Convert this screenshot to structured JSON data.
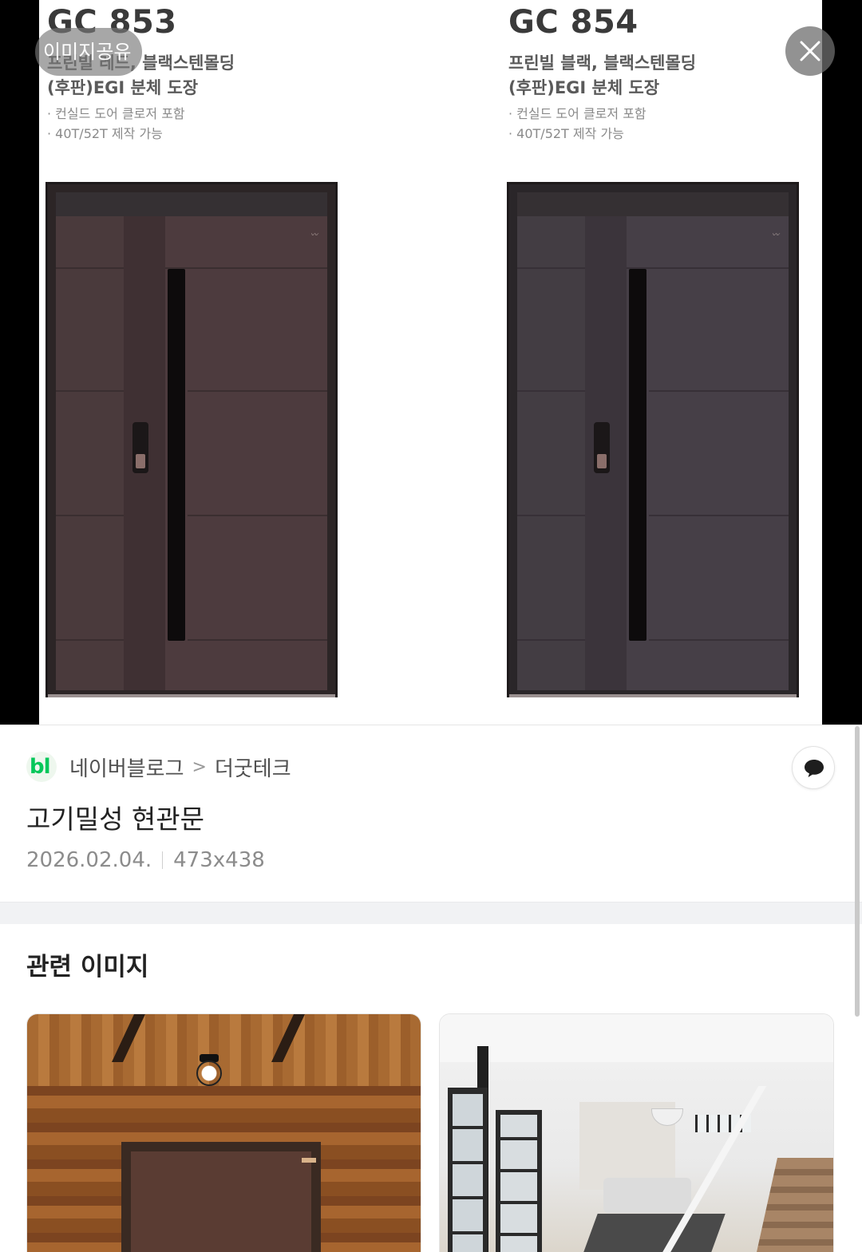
{
  "viewer": {
    "share_label": "이미지공유",
    "products": [
      {
        "model": "GC 853",
        "finish_line1": "프린빌 레드, 블랙스텐몰딩",
        "finish_line2": "(후판)EGI 분체 도장",
        "bullet1": "· 컨실드 도어 클로저 포함",
        "bullet2": "· 40T/52T 제작 가능"
      },
      {
        "model": "GC 854",
        "finish_line1": "프린빌 블랙, 블랙스텐몰딩",
        "finish_line2": "(후판)EGI 분체 도장",
        "bullet1": "· 컨실드 도어 클로저 포함",
        "bullet2": "· 40T/52T 제작 가능"
      }
    ]
  },
  "info": {
    "source_logo": "bl",
    "source_name": "네이버블로그",
    "separator": ">",
    "blog_name": "더굿테크",
    "title": "고기밀성 현관문",
    "date": "2026.02.04.",
    "dimensions": "473x438"
  },
  "related": {
    "heading": "관련 이미지"
  },
  "colors": {
    "naver_green": "#03c75a",
    "door_red_brown": "#4d3b3e",
    "door_black_brown": "#463f47"
  },
  "icons": {
    "close": "close-icon",
    "comment": "speech-bubble-icon",
    "source": "naver-blog-icon"
  }
}
